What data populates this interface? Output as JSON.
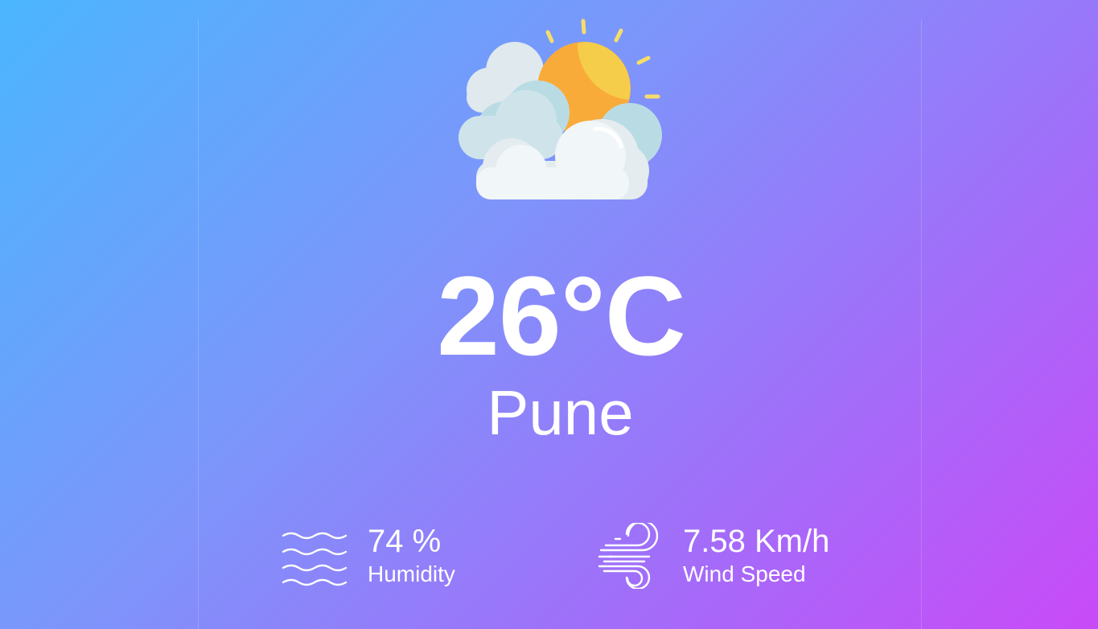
{
  "weather": {
    "condition_icon": "partly-cloudy-icon",
    "temperature": "26°C",
    "city": "Pune"
  },
  "details": {
    "humidity": {
      "icon": "humidity-waves-icon",
      "value": "74 %",
      "label": "Humidity"
    },
    "wind": {
      "icon": "wind-icon",
      "value": "7.58 Km/h",
      "label": "Wind Speed"
    }
  },
  "colors": {
    "gradient_start": "#4bb6fd",
    "gradient_end": "#c94af8",
    "text": "#ffffff"
  }
}
